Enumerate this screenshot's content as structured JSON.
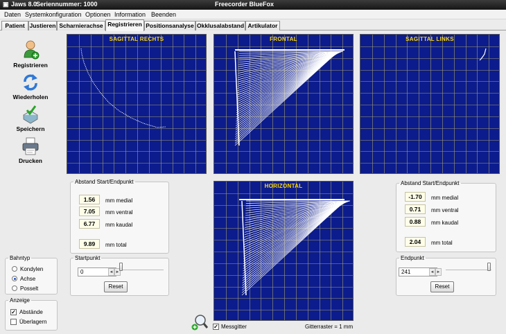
{
  "titlebar": {
    "app": "Jaws 8.0",
    "serial": "Seriennummer: 1000",
    "device": "Freecorder BlueFox"
  },
  "menu": [
    "Daten",
    "Systemkonfiguration",
    "Optionen",
    "Information",
    "Beenden"
  ],
  "tabs": [
    "Patient",
    "Justieren",
    "Scharnierachse",
    "Registrieren",
    "Positionsanalyse",
    "Okklusalabstand",
    "Artikulator"
  ],
  "active_tab": "Registrieren",
  "sidebar": {
    "register": "Registrieren",
    "reload": "Wiederholen",
    "save": "Speichern",
    "print": "Drucken"
  },
  "panels": {
    "sagittal_right": "SAGITTAL RECHTS",
    "frontal": "FRONTAL",
    "sagittal_left": "SAGITTAL LINKS",
    "horizontal": "HORIZONTAL"
  },
  "distance_left": {
    "title": "Abstand Start/Endpunkt",
    "medial": "1.56",
    "ventral": "7.05",
    "kaudal": "6.77",
    "total": "9.89"
  },
  "distance_right": {
    "title": "Abstand Start/Endpunkt",
    "medial": "-1.70",
    "ventral": "0.71",
    "kaudal": "0.88",
    "total": "2.04"
  },
  "units": {
    "medial": "mm medial",
    "ventral": "mm ventral",
    "kaudal": "mm kaudal",
    "total": "mm total"
  },
  "startpoint": {
    "label": "Startpunkt",
    "value": "0",
    "position": 0,
    "reset": "Reset"
  },
  "endpoint": {
    "label": "Endpunkt",
    "value": "241",
    "position": 1,
    "reset": "Reset"
  },
  "path_type": {
    "label": "Bahntyp",
    "options": [
      "Kondylen",
      "Achse",
      "Posselt"
    ],
    "selected": "Achse"
  },
  "display": {
    "label": "Anzeige",
    "distances": "Abstände",
    "distances_checked": true,
    "overlay": "Überlagern",
    "overlay_checked": false
  },
  "grid": {
    "label": "Messgitter",
    "checked": true,
    "scale": "Gitterraster = 1 mm"
  },
  "colors": {
    "plot_bg": "#0c1c8c",
    "grid": "#a6a06a",
    "title": "#ffd800",
    "trace": "#ffffff"
  }
}
